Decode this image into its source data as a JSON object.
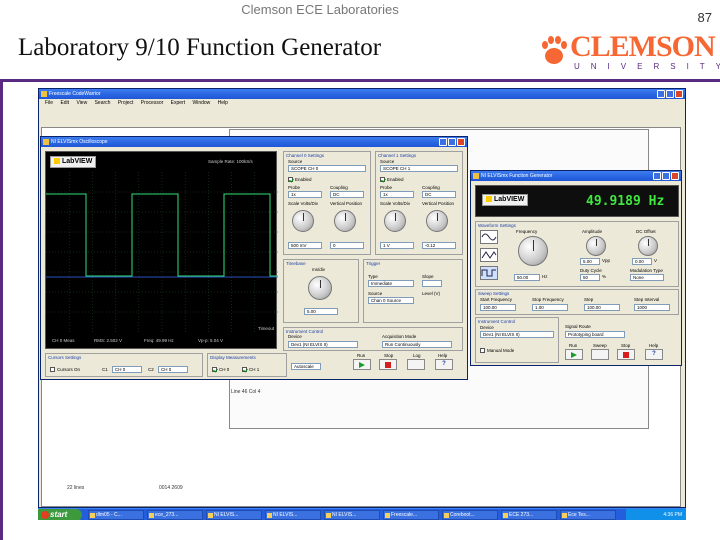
{
  "slide": {
    "course": "Clemson ECE Laboratories",
    "title": "Laboratory 9/10 Function Generator",
    "page_number": "87",
    "logo_word": "CLEMSON",
    "logo_sub": "UNIVERSITY",
    "accent_color": "#5a2a82",
    "logo_color": "#f66733"
  },
  "desktop": {
    "background_window": {
      "title": "Freescale CodeWarrior",
      "menu": "File  Edit  View  Search  Project  Processor Expert  Window  Help",
      "status": "Line 46    Col 4",
      "bottom_left": "22 lines",
      "bottom_mid": "0014    2609"
    },
    "scope": {
      "title": "NI ELVISmx Oscilloscope",
      "logo": "LabVIEW",
      "readout_top": "Sample Rate: 100kS/s",
      "readout_bottom": [
        "CH 0 Meas",
        "RMS: 2.502 V",
        "Freq: 49.99 Hz",
        "Vp-p: 5.04 V"
      ],
      "timeout_label": "Timeout",
      "channel0": {
        "heading": "Channel 0 Settings",
        "source_label": "Source",
        "source": "SCOPE CH 0",
        "enabled": "Enabled",
        "probe_label": "Probe",
        "probe": "1x",
        "coupling_label": "Coupling",
        "coupling": "DC",
        "scale_label": "Scale Volts/Div",
        "scale": "500 mV",
        "position_label": "Vertical Position",
        "position": "0"
      },
      "channel1": {
        "heading": "Channel 1 Settings",
        "source_label": "Source",
        "source": "SCOPE CH 1",
        "enabled": "Enabled",
        "probe_label": "Probe",
        "probe": "1x",
        "coupling_label": "Coupling",
        "coupling": "DC",
        "scale_label": "Scale Volts/Div",
        "scale": "1 V",
        "position_label": "Vertical Position",
        "position": "-0.12"
      },
      "timebase": {
        "heading": "Timebase",
        "unit": "ms/div",
        "value": "5.00"
      },
      "trigger": {
        "heading": "Trigger",
        "type_label": "Type",
        "type": "Immediate",
        "source_label": "Source",
        "source": "Chan 0 Source",
        "slope_label": "Slope",
        "level_label": "Level (V)"
      },
      "instrument": {
        "heading": "Instrument Control",
        "device_label": "Device",
        "device": "Dev1 (NI ELVIS II)",
        "acq_label": "Acquisition Mode",
        "acq": "Run Continuously"
      },
      "cursors": {
        "heading": "Cursors Settings",
        "cursors_on": "Cursors On",
        "c1": "C1",
        "c1_ch": "CH 0",
        "c2": "C2",
        "c2_ch": "CH 0"
      },
      "display": {
        "heading": "Display Measurements",
        "ch0": "CH 0",
        "ch1": "CH 1"
      },
      "log_label": "Autoscale",
      "run_label": "Run",
      "stop_label": "Stop",
      "log_btn_label": "Log",
      "help_label": "Help"
    },
    "funcgen": {
      "title": "NI ELVISmx Function Generator",
      "logo": "LabVIEW",
      "frequency": "49.9189 Hz",
      "waveform_heading": "Waveform Settings",
      "frequency_label": "Frequency",
      "amplitude_label": "Amplitude",
      "offset_label": "DC Offset",
      "freq_value": "50.00",
      "freq_unit": "Hz",
      "amp_value": "5.00",
      "amp_unit": "Vpp",
      "offset_value": "0.00",
      "offset_unit": "V",
      "duty_label": "Duty Cycle",
      "duty_value": "50",
      "duty_unit": "%",
      "modulation_label": "Modulation Type",
      "modulation_value": "None",
      "sweep_heading": "Sweep Settings",
      "start_label": "Start Frequency",
      "start_value": "100.00",
      "stop_label": "Stop Frequency",
      "stop_value": "1.00",
      "step_label": "Step",
      "step_value": "100.00",
      "interval_label": "Step Interval",
      "interval_value": "1000",
      "instrument_heading": "Instrument Control",
      "device_label": "Device",
      "device_value": "Dev1 (NI ELVIS II)",
      "signal_label": "Signal Route",
      "signal_value": "Prototyping board",
      "manual_label": "Manual Mode",
      "run_label": "Run",
      "sweep_label": "Sweep",
      "stop_btn_label": "Stop",
      "help_label": "Help"
    },
    "taskbar": {
      "start": "start",
      "items": [
        "dlm05 - C...",
        "ece_273...",
        "NI ELVIS...",
        "NI ELVIS...",
        "NI ELVIS...",
        "Freescale...",
        "Coreboot...",
        "ECE 273...",
        "Ece Tes..."
      ],
      "clock": "4:36 PM"
    },
    "scope_trace": {
      "ch0_color": "#2fe07a",
      "ch1_color": "#3a6bff",
      "grid_color": "#1f4f2a"
    }
  }
}
